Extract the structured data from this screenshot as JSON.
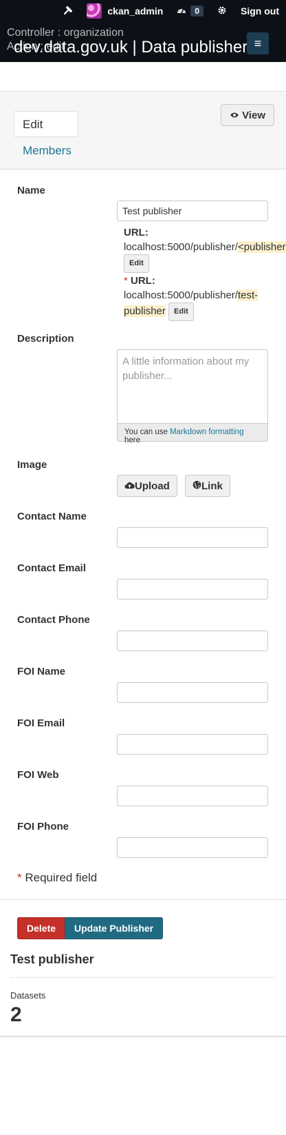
{
  "topbar": {
    "username": "ckan_admin",
    "activity_count": "0",
    "signout_label": "Sign out",
    "debug_controller": "Controller : organization",
    "debug_action": "Action : edit",
    "site_title": "dev.data.gov.uk | Data publisher"
  },
  "tabs": {
    "edit_label": "Edit",
    "members_label": "Members",
    "view_label": "View"
  },
  "form": {
    "name_label": "Name",
    "name_value": "Test publisher",
    "url1_key": "URL:",
    "url1_prefix": "localhost:5000/publisher/",
    "url1_slug": "<publisher>",
    "url_edit_label": "Edit",
    "url2_star": "*",
    "url2_key": "URL:",
    "url2_prefix": "localhost:5000/publisher/",
    "url2_slug": "test-publisher",
    "description_label": "Description",
    "description_placeholder": "A little information about my publisher...",
    "markdown_prefix": "You can use",
    "markdown_link": "Markdown formatting",
    "markdown_suffix": "here",
    "image_label": "Image",
    "upload_label": "Upload",
    "link_label": "Link",
    "contact_name_label": "Contact Name",
    "contact_email_label": "Contact Email",
    "contact_phone_label": "Contact Phone",
    "foi_name_label": "FOI Name",
    "foi_email_label": "FOI Email",
    "foi_web_label": "FOI Web",
    "foi_phone_label": "FOI Phone",
    "required_star": "*",
    "required_text": "Required field"
  },
  "actions": {
    "delete_label": "Delete",
    "update_label": "Update Publisher"
  },
  "info": {
    "title": "Test publisher",
    "datasets_label": "Datasets",
    "datasets_count": "2"
  },
  "colors": {
    "topbar_bg": "#0d1117",
    "link": "#187794",
    "delete": "#c6302a",
    "primary": "#206b82"
  }
}
